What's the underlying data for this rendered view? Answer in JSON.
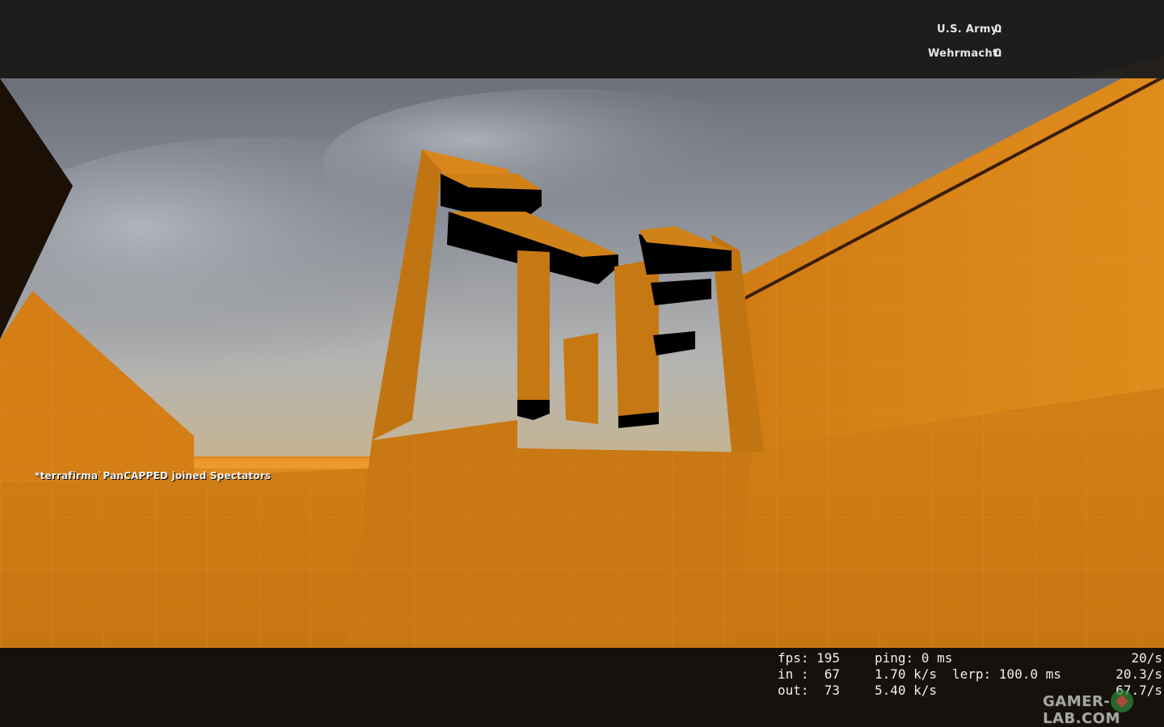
{
  "scoreboard": {
    "teams": [
      {
        "name": "U.S. Army:",
        "score": "0"
      },
      {
        "name": "Wehrmacht:",
        "score": "0"
      }
    ]
  },
  "chat": {
    "message": "*terrafirma`PanCAPPED joined Spectators"
  },
  "netgraph": {
    "rows": [
      {
        "c1": "fps: 195",
        "c2": "ping: 0 ms",
        "c3": "",
        "c4": "20/s"
      },
      {
        "c1": "in :  67",
        "c2": "1.70 k/s",
        "c3": "lerp: 100.0 ms",
        "c4": "20.3/s"
      },
      {
        "c1": "out:  73",
        "c2": "5.40 k/s",
        "c3": "",
        "c4": "67.7/s"
      }
    ]
  },
  "watermark": {
    "text": "GAMER-LAB.COM"
  },
  "colors": {
    "orange": "#d98218",
    "orange_dark": "#b8680e",
    "orange_shadow": "#a35a0c",
    "sky": "#8a8f99",
    "hud_bar": "#1d1d1e"
  },
  "icons": [
    "gamer-lab-logo-icon"
  ]
}
